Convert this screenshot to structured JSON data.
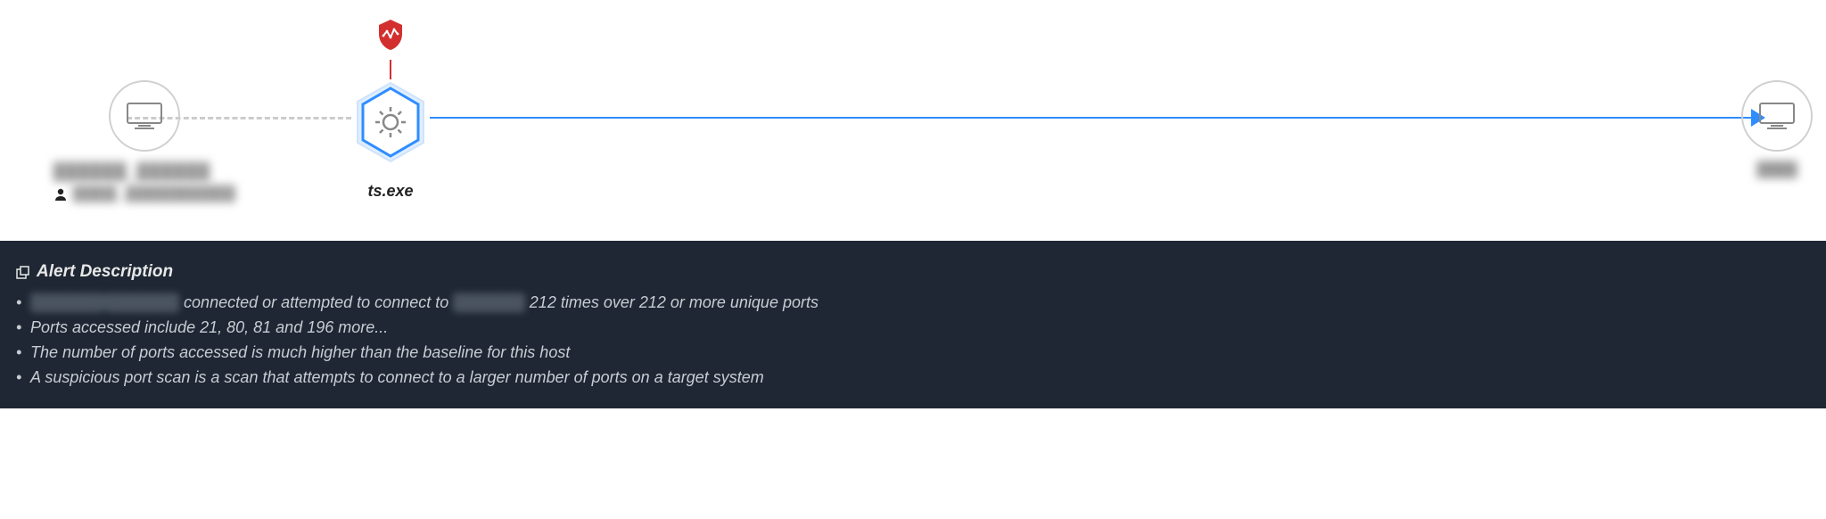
{
  "diagram": {
    "source": {
      "hostname": "██████_██████",
      "user": "████_██████████"
    },
    "process": {
      "label": "ts.exe",
      "threat_icon": "activity-icon"
    },
    "target": {
      "hostname": "████"
    },
    "edges": {
      "source_to_process": "dashed",
      "process_to_target": "arrow"
    }
  },
  "alert": {
    "header": "Alert Description",
    "lines": [
      {
        "prefix_redacted": "██████_██████",
        "mid": " connected or attempted to connect to ",
        "mid_redacted": "██████",
        "suffix": "212 times over 212 or more unique ports"
      },
      {
        "text": "Ports accessed include 21, 80, 81 and 196 more..."
      },
      {
        "text": "The number of ports accessed is much higher than the baseline for this host"
      },
      {
        "text": "A suspicious port scan is a scan that attempts to connect to a larger number of ports on a target system"
      }
    ]
  }
}
